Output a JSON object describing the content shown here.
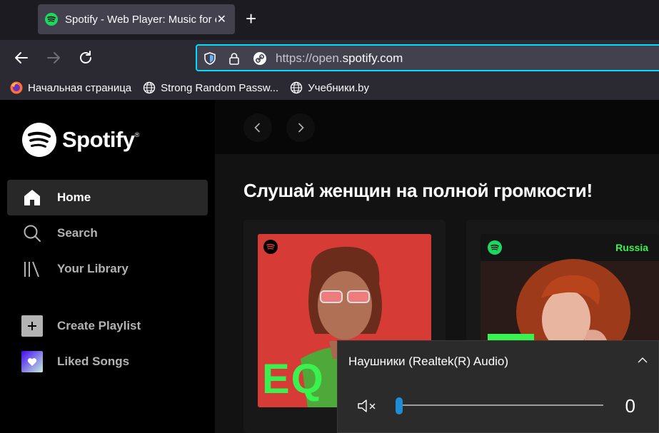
{
  "browser": {
    "tab": {
      "title": "Spotify - Web Player: Music for everyone",
      "close": "✕"
    },
    "new_tab": "+",
    "url": {
      "prefix": "https://open.",
      "domain": "spotify.com"
    },
    "bookmarks": [
      {
        "label": "Начальная страница",
        "icon": "firefox-icon"
      },
      {
        "label": "Strong Random Passw...",
        "icon": "globe-icon"
      },
      {
        "label": "Учебники.by",
        "icon": "globe-icon"
      }
    ]
  },
  "spotify": {
    "brand": "Spotify",
    "brand_mark": "®",
    "nav": [
      {
        "label": "Home",
        "icon": "home-icon",
        "active": true
      },
      {
        "label": "Search",
        "icon": "search-icon",
        "active": false
      },
      {
        "label": "Your Library",
        "icon": "library-icon",
        "active": false
      }
    ],
    "actions": [
      {
        "label": "Create Playlist",
        "icon": "plus-icon"
      },
      {
        "label": "Liked Songs",
        "icon": "heart-icon"
      }
    ],
    "section_title": "Слушай женщин на полной громкости!",
    "cards": [
      {
        "cover_text": "EQ"
      },
      {
        "badge": "Russia"
      }
    ]
  },
  "volume_flyout": {
    "device": "Наушники (Realtek(R) Audio)",
    "value": "0",
    "level": 0
  },
  "colors": {
    "spotify_green": "#1ed760",
    "url_focus": "#00ddff",
    "slider_accent": "#1f8dd6"
  }
}
